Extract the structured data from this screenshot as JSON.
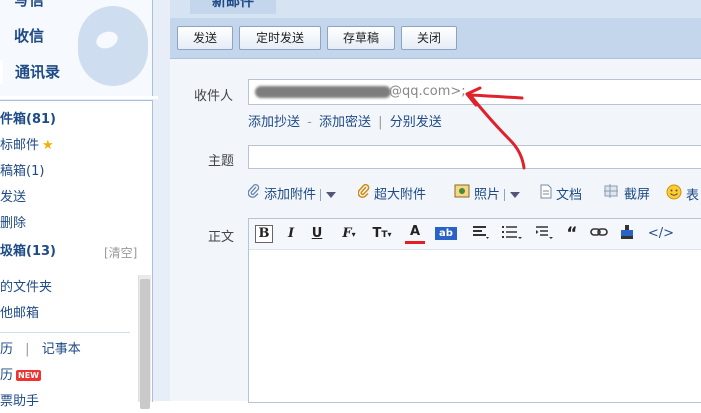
{
  "sidebar": {
    "write": "写信",
    "inbox": "收信",
    "contacts": "通讯录",
    "folders": [
      {
        "label": "件箱(81)",
        "bold": true
      },
      {
        "label": "标邮件",
        "star": true
      },
      {
        "label": "稿箱(1)"
      },
      {
        "label": "发送"
      },
      {
        "label": "删除"
      },
      {
        "label": "圾箱(13)",
        "bold": true
      }
    ],
    "clear": "[清空]",
    "my_folders": "的文件夹",
    "other_mailbox": "他邮箱",
    "apps_row1_a": "历",
    "apps_row1_sep": "|",
    "apps_row1_b": "记事本",
    "apps_row2": "历",
    "new_badge": "NEW",
    "apps_row3": "票助手"
  },
  "tab": {
    "label": "新邮件"
  },
  "toolbar": {
    "send": "发送",
    "scheduled_send": "定时发送",
    "save_draft": "存草稿",
    "close": "关闭"
  },
  "compose": {
    "to_label": "收件人",
    "to_value_visible": "@qq.com>;",
    "add_cc": "添加抄送",
    "dash": "-",
    "add_bcc": "添加密送",
    "pipe": "|",
    "separate_send": "分别发送",
    "subject_label": "主题",
    "subject_value": "",
    "body_label": "正文"
  },
  "attachments": {
    "add_attachment": "添加附件",
    "large_attachment": "超大附件",
    "photo": "照片",
    "document": "文档",
    "screenshot": "截屏",
    "emoji": "表"
  },
  "editor_toolbar": {
    "bold": "B",
    "italic": "I",
    "underline": "U",
    "font": "F",
    "size": "T",
    "color": "A",
    "bg": "ab",
    "quote": "“",
    "source": "</>"
  },
  "colors": {
    "accent": "#1e4a86",
    "panel": "#c3d6ec",
    "annotation": "#e0202a"
  }
}
